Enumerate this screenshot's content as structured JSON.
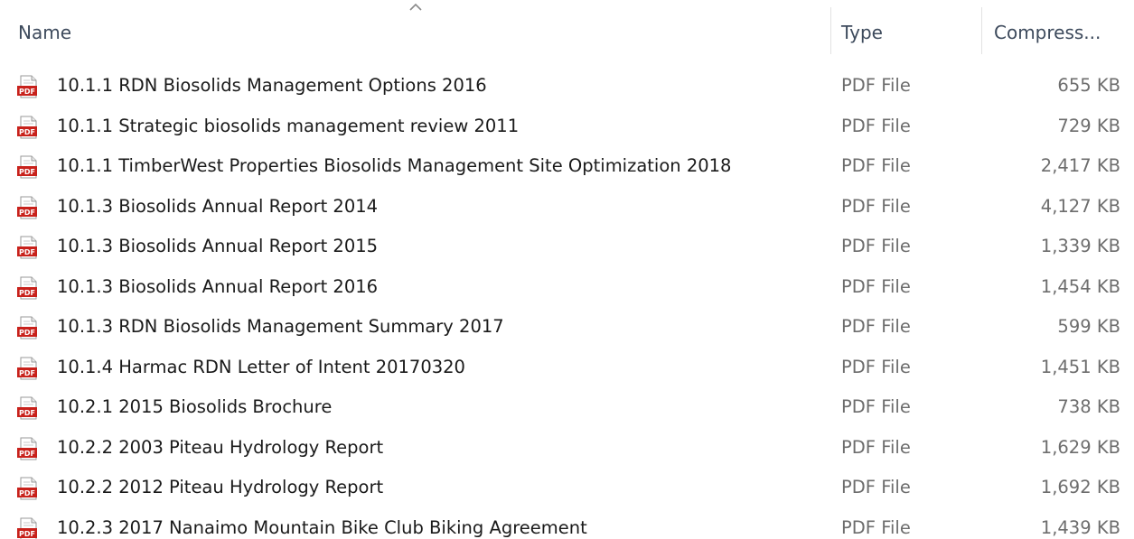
{
  "columns": {
    "name": "Name",
    "type": "Type",
    "size": "Compress..."
  },
  "sort": {
    "column": "name",
    "direction": "ascending",
    "icon": "chevron-up-icon"
  },
  "file_icon": "pdf-file-icon",
  "colors": {
    "header_text": "#3d4a5c",
    "name_text": "#1a1a1a",
    "meta_text": "#6d6d6d",
    "pdf_red": "#c8211b"
  },
  "files": [
    {
      "name": "10.1.1 RDN Biosolids Management Options 2016",
      "type": "PDF File",
      "size": "655 KB"
    },
    {
      "name": "10.1.1 Strategic biosolids management review 2011",
      "type": "PDF File",
      "size": "729 KB"
    },
    {
      "name": "10.1.1 TimberWest Properties Biosolids Management Site Optimization 2018",
      "type": "PDF File",
      "size": "2,417 KB"
    },
    {
      "name": "10.1.3 Biosolids Annual Report 2014",
      "type": "PDF File",
      "size": "4,127 KB"
    },
    {
      "name": "10.1.3 Biosolids Annual Report 2015",
      "type": "PDF File",
      "size": "1,339 KB"
    },
    {
      "name": "10.1.3 Biosolids Annual Report 2016",
      "type": "PDF File",
      "size": "1,454 KB"
    },
    {
      "name": "10.1.3 RDN Biosolids Management Summary 2017",
      "type": "PDF File",
      "size": "599 KB"
    },
    {
      "name": "10.1.4 Harmac RDN Letter of Intent 20170320",
      "type": "PDF File",
      "size": "1,451 KB"
    },
    {
      "name": "10.2.1 2015 Biosolids Brochure",
      "type": "PDF File",
      "size": "738 KB"
    },
    {
      "name": "10.2.2 2003 Piteau Hydrology Report",
      "type": "PDF File",
      "size": "1,629 KB"
    },
    {
      "name": "10.2.2 2012 Piteau Hydrology Report",
      "type": "PDF File",
      "size": "1,692 KB"
    },
    {
      "name": "10.2.3 2017 Nanaimo Mountain Bike Club Biking Agreement",
      "type": "PDF File",
      "size": "1,439 KB"
    }
  ]
}
